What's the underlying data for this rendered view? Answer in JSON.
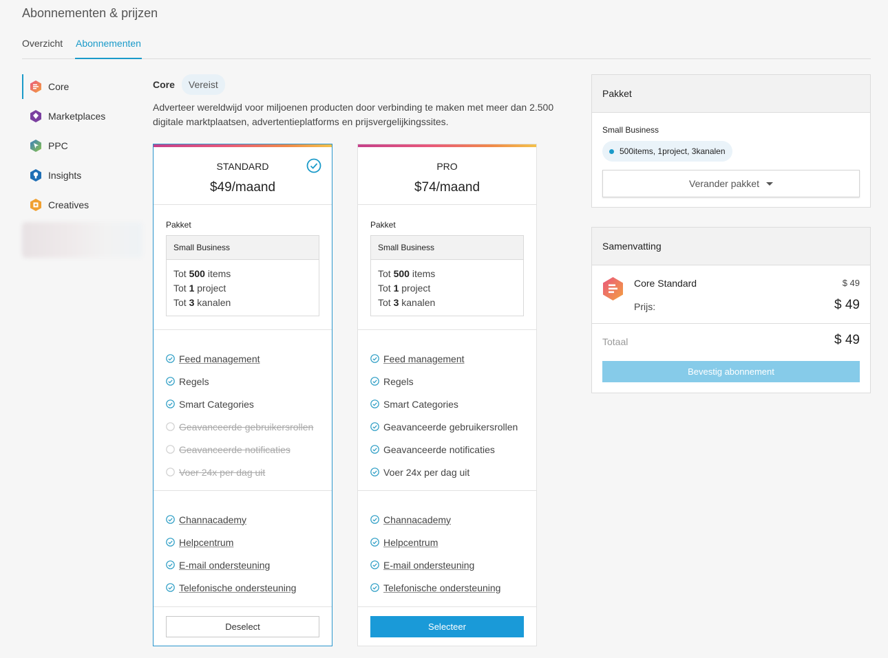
{
  "page": {
    "title": "Abonnementen & prijzen"
  },
  "tabs": [
    {
      "label": "Overzicht"
    },
    {
      "label": "Abonnementen"
    }
  ],
  "sidebar": {
    "items": [
      {
        "label": "Core",
        "icon": "core-icon",
        "color": "#f07a4a"
      },
      {
        "label": "Marketplaces",
        "icon": "marketplaces-icon",
        "color": "#7b3fa0"
      },
      {
        "label": "PPC",
        "icon": "ppc-icon",
        "color": "#4aa88a"
      },
      {
        "label": "Insights",
        "icon": "insights-icon",
        "color": "#1f6fb5"
      },
      {
        "label": "Creatives",
        "icon": "creatives-icon",
        "color": "#f0a030"
      }
    ]
  },
  "core": {
    "label": "Core",
    "badge": "Vereist",
    "description": "Adverteer wereldwijd voor miljoenen producten door verbinding te maken met meer dan 2.500 digitale marktplaatsen, advertentieplatforms en prijsvergelijkingssites."
  },
  "plans": [
    {
      "name": "STANDARD",
      "price": "$49/maand",
      "selected": true,
      "package_title": "Pakket",
      "package_name": "Small Business",
      "limits": [
        {
          "pre": "Tot ",
          "num": "500",
          "post": " items"
        },
        {
          "pre": "Tot ",
          "num": "1",
          "post": " project"
        },
        {
          "pre": "Tot ",
          "num": "3",
          "post": " kanalen"
        }
      ],
      "features": [
        {
          "label": "Feed management",
          "on": true,
          "link": true
        },
        {
          "label": "Regels",
          "on": true,
          "link": false
        },
        {
          "label": "Smart Categories",
          "on": true,
          "link": false
        },
        {
          "label": "Geavanceerde gebruikersrollen",
          "on": false,
          "link": false
        },
        {
          "label": "Geavanceerde notificaties",
          "on": false,
          "link": false
        },
        {
          "label": "Voer 24x per dag uit",
          "on": false,
          "link": false
        }
      ],
      "support": [
        {
          "label": "Channacademy"
        },
        {
          "label": "Helpcentrum"
        },
        {
          "label": "E-mail ondersteuning"
        },
        {
          "label": "Telefonische ondersteuning"
        }
      ],
      "button": "Deselect"
    },
    {
      "name": "PRO",
      "price": "$74/maand",
      "selected": false,
      "package_title": "Pakket",
      "package_name": "Small Business",
      "limits": [
        {
          "pre": "Tot ",
          "num": "500",
          "post": " items"
        },
        {
          "pre": "Tot ",
          "num": "1",
          "post": " project"
        },
        {
          "pre": "Tot ",
          "num": "3",
          "post": " kanalen"
        }
      ],
      "features": [
        {
          "label": "Feed management",
          "on": true,
          "link": true
        },
        {
          "label": "Regels",
          "on": true,
          "link": false
        },
        {
          "label": "Smart Categories",
          "on": true,
          "link": false
        },
        {
          "label": "Geavanceerde gebruikersrollen",
          "on": true,
          "link": false
        },
        {
          "label": "Geavanceerde notificaties",
          "on": true,
          "link": false
        },
        {
          "label": "Voer 24x per dag uit",
          "on": true,
          "link": false
        }
      ],
      "support": [
        {
          "label": "Channacademy"
        },
        {
          "label": "Helpcentrum"
        },
        {
          "label": "E-mail ondersteuning"
        },
        {
          "label": "Telefonische ondersteuning"
        }
      ],
      "button": "Selecteer"
    }
  ],
  "package_panel": {
    "title": "Pakket",
    "name": "Small Business",
    "chip": {
      "items_num": "500",
      "items_text": " items,",
      "project_num": "1",
      "project_text": " project,",
      "channels_num": "3",
      "channels_text": " kanalen"
    },
    "change_button": "Verander pakket"
  },
  "summary": {
    "title": "Samenvatting",
    "item_name": "Core Standard",
    "item_price": "$ 49",
    "price_label": "Prijs:",
    "price_value": "$ 49",
    "total_label": "Totaal",
    "total_value": "$ 49",
    "confirm_button": "Bevestig abonnement"
  },
  "colors": {
    "accent": "#1a9ac9",
    "primary_button": "#1a9ad8",
    "confirm_button_disabled": "#86cbe9"
  }
}
